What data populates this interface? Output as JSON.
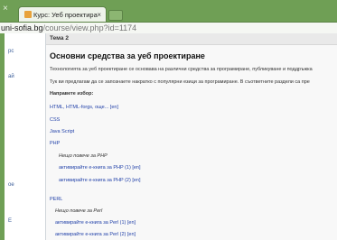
{
  "browser": {
    "tab_title": "Курс: Уеб проектира",
    "tab_close": "×",
    "address_host": "uni-sofia.bg",
    "address_path": "/course/view.php?id=1174"
  },
  "sidebar": {
    "fragments": [
      "рс",
      "ай",
      "ое",
      "Е"
    ]
  },
  "section": {
    "label": "Тема 2",
    "title": "Основни средства за уеб проектиране",
    "intro1": "Технологията за уеб проектиране се основава на различни средства за програмиране, публикуване и поддръжка",
    "intro2": "Тук ви предлагам да се запознаете накратко с популярни езици за програмиране. В съответните раздели са пре",
    "directions_heading": "Направете избор:"
  },
  "links": {
    "html": "HTML, HTML-forgs, още... [en]",
    "css": "CSS",
    "js": "Java Script",
    "php": "PHP",
    "php_note": "Нещо повече за PHP",
    "php_ebook1": "активирайте е-книга за PHP (1) [en]",
    "php_ebook2": "активирайте е-книга за PHP (2) [en]",
    "perl": "PERL",
    "perl_note": "Нещо повече за Perl",
    "perl_ebook1": "активирайте е-книга за Perl (1) [en]",
    "perl_ebook2": "активирайте е-книга за Perl (2) [en]"
  }
}
